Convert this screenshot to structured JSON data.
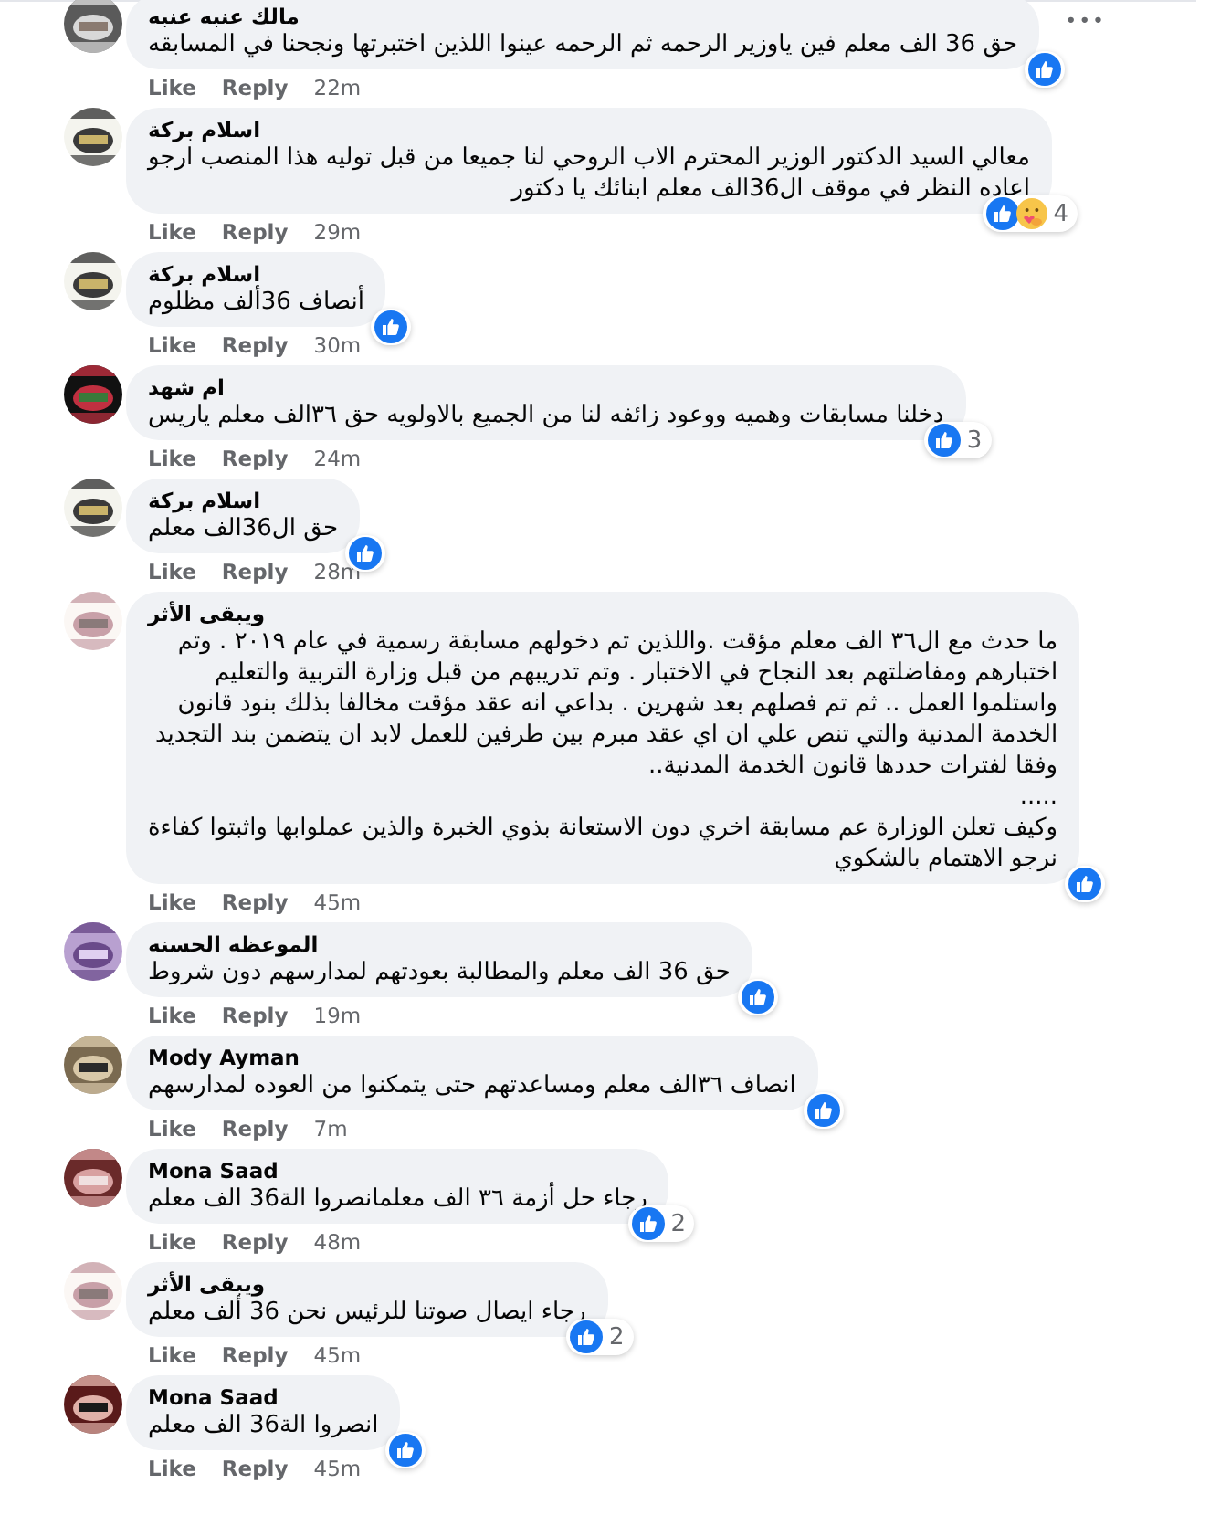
{
  "comments": [
    {
      "name": "مالك عنبه عنبه",
      "text": [
        "حق 36 الف معلم فين ياوزير الرحمه ثم الرحمه عينوا اللذين اختبرتها ونجحنا في المسابقه"
      ],
      "reactions": [
        {
          "kind": "like"
        }
      ],
      "like_label": "Like",
      "reply_label": "Reply",
      "time": "22m",
      "menu": "•••"
    },
    {
      "name": "اسلام بركة",
      "text": [
        "معالي السيد الدكتور الوزير المحترم الاب الروحي لنا جميعا من قبل توليه هذا المنصب ارجو",
        "اعاده النظر في موقف ال36الف معلم ابنائك يا دكتور"
      ],
      "reactions": [
        {
          "kind": "like"
        },
        {
          "kind": "care"
        }
      ],
      "reaction_count": "4",
      "like_label": "Like",
      "reply_label": "Reply",
      "time": "29m"
    },
    {
      "name": "اسلام بركة",
      "text": [
        "أنصاف 36ألف مظلوم"
      ],
      "reactions": [
        {
          "kind": "like"
        }
      ],
      "like_label": "Like",
      "reply_label": "Reply",
      "time": "30m"
    },
    {
      "name": "ام شهد",
      "text": [
        "دخلنا مسابقات وهميه ووعود زائفه لنا من الجميع بالاولويه حق ٣٦الف معلم ياريس"
      ],
      "reactions": [
        {
          "kind": "like"
        }
      ],
      "reaction_count": "3",
      "like_label": "Like",
      "reply_label": "Reply",
      "time": "24m"
    },
    {
      "name": "اسلام بركة",
      "text": [
        "حق ال36الف معلم"
      ],
      "reactions": [
        {
          "kind": "like"
        }
      ],
      "like_label": "Like",
      "reply_label": "Reply",
      "time": "28m"
    },
    {
      "name": "ويبقى الأثر",
      "text": [
        "ما حدث مع ال٣٦ الف معلم مؤقت .واللذين تم دخولهم مسابقة رسمية في عام ٢٠١٩ . وتم",
        "اختبارهم ومفاضلتهم بعد النجاح في الاختبار . وتم تدريبهم من قبل وزارة التربية والتعليم",
        "واستلموا العمل .. ثم تم فصلهم بعد شهرين . بداعي انه عقد مؤقت مخالفا بذلك بنود قانون",
        "الخدمة المدنية والتي تنص علي ان اي عقد مبرم بين طرفين للعمل لابد ان يتضمن بند التجديد",
        "وفقا لفترات حددها قانون الخدمة المدنية..",
        ".....",
        "وكيف تعلن الوزارة عم مسابقة اخري دون الاستعانة بذوي الخبرة والذين عملوابها واثبتوا كفاءة",
        "نرجو الاهتمام بالشكوي"
      ],
      "reactions": [
        {
          "kind": "like"
        }
      ],
      "like_label": "Like",
      "reply_label": "Reply",
      "time": "45m"
    },
    {
      "name": "الموعظه الحسنه",
      "text": [
        "حق 36 الف معلم والمطالبة بعودتهم لمدارسهم دون شروط"
      ],
      "reactions": [
        {
          "kind": "like"
        }
      ],
      "like_label": "Like",
      "reply_label": "Reply",
      "time": "19m"
    },
    {
      "name": "Mody Ayman",
      "text": [
        "انصاف ٣٦الف معلم ومساعدتهم حتى يتمكنوا من العوده لمدارسهم"
      ],
      "reactions": [
        {
          "kind": "like"
        }
      ],
      "like_label": "Like",
      "reply_label": "Reply",
      "time": "7m"
    },
    {
      "name": "Mona Saad",
      "text": [
        "رجاء حل أزمة ٣٦ الف معلمانصروا الة36 الف معلم"
      ],
      "reactions": [
        {
          "kind": "like"
        }
      ],
      "reaction_count": "2",
      "like_label": "Like",
      "reply_label": "Reply",
      "time": "48m"
    },
    {
      "name": "ويبقى الأثر",
      "text": [
        "رجاء ايصال صوتنا للرئيس نحن 36 ألف معلم"
      ],
      "reactions": [
        {
          "kind": "like"
        }
      ],
      "reaction_count": "2",
      "like_label": "Like",
      "reply_label": "Reply",
      "time": "45m"
    },
    {
      "name": "Mona Saad",
      "text": [
        "انصروا الة36 الف معلم"
      ],
      "reactions": [
        {
          "kind": "like"
        }
      ],
      "like_label": "Like",
      "reply_label": "Reply",
      "time": "45m"
    }
  ]
}
